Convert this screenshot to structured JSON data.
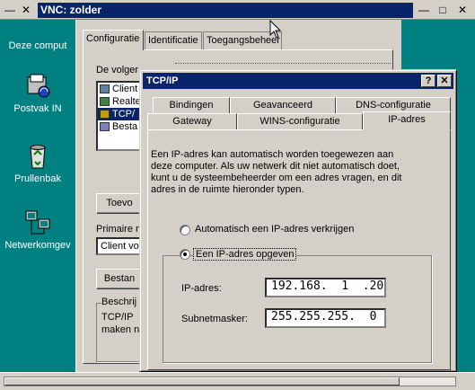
{
  "vnc": {
    "title": "VNC: zolder",
    "minimize_glyph": "—",
    "restore_glyph": "□",
    "close_glyph": "✕"
  },
  "desktop": {
    "icons": [
      {
        "label": "Deze comput",
        "icon": "my-computer-icon"
      },
      {
        "label": "Postvak IN",
        "icon": "inbox-icon"
      },
      {
        "label": "Prullenbak",
        "icon": "recycle-bin-icon"
      },
      {
        "label": "Netwerkomgev",
        "icon": "network-neighborhood-icon"
      }
    ]
  },
  "network_properties": {
    "tabs": [
      "Configuratie",
      "Identificatie",
      "Toegangsbeheer"
    ],
    "active_tab": "Configuratie",
    "component_list_label": "De volger",
    "components": [
      {
        "label": "Client",
        "icon": "client-icon"
      },
      {
        "label": "Realte",
        "icon": "adapter-icon"
      },
      {
        "label": "TCP/",
        "icon": "protocol-icon",
        "selected": true
      },
      {
        "label": "Besta",
        "icon": "file-sharing-icon"
      }
    ],
    "add_button": "Toevo",
    "primary_logon_label": "Primaire n",
    "primary_logon_value": "Client vo",
    "file_sharing_button": "Bestan",
    "description_group_label": "Beschrij",
    "description_text_1": "TCP/IP",
    "description_text_2": "maken n"
  },
  "tcpip_dialog": {
    "title": "TCP/IP",
    "help_glyph": "?",
    "close_glyph": "✕",
    "tabs_back_row": [
      "Bindingen",
      "Geavanceerd",
      "DNS-configuratie"
    ],
    "tabs_front_row": [
      "Gateway",
      "WINS-configuratie",
      "IP-adres"
    ],
    "active_tab": "IP-adres",
    "description": "Een IP-adres kan automatisch worden toegewezen aan deze computer. Als uw netwerk dit niet automatisch doet, kunt u de systeembeheerder om een adres vragen, en dit adres in de ruimte hieronder typen.",
    "option_auto": "Automatisch een IP-adres verkrijgen",
    "option_manual": "Een IP-adres opgeven",
    "selected_option": "manual",
    "ip_label": "IP-adres:",
    "ip_value": "192.168.  1  .20",
    "subnet_label": "Subnetmasker:",
    "subnet_value": "255.255.255.  0"
  },
  "colors": {
    "desktop": "#008080",
    "titlebar": "#0a246a",
    "face": "#d4d0c8"
  }
}
